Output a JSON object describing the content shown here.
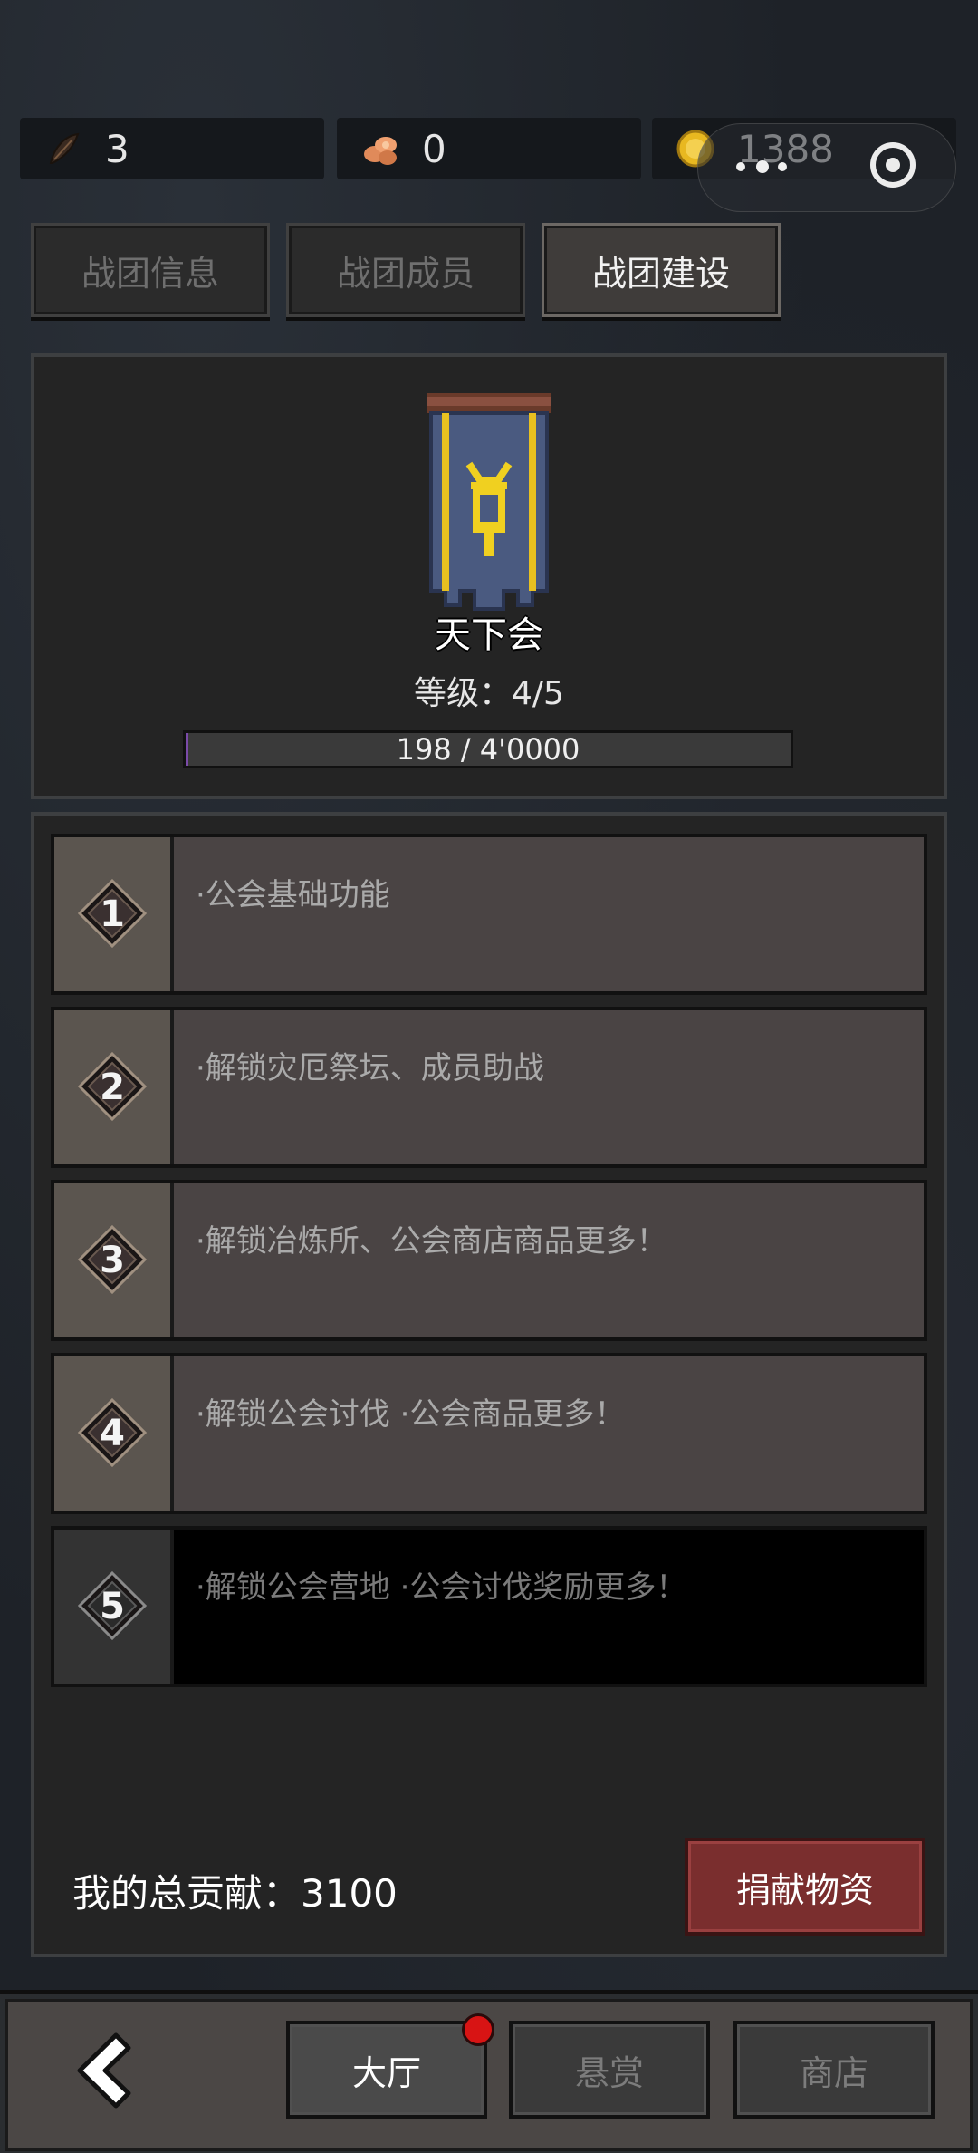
{
  "resources": {
    "feather": {
      "value": "3",
      "icon": "feather-icon"
    },
    "wood": {
      "value": "0",
      "icon": "wood-icon"
    },
    "gold": {
      "value": "1388",
      "icon": "gold-coin-icon"
    }
  },
  "tabs": [
    {
      "label": "战团信息",
      "active": false
    },
    {
      "label": "战团成员",
      "active": false
    },
    {
      "label": "战团建设",
      "active": true
    }
  ],
  "guild": {
    "name": "天下会",
    "level_text": "等级：4/5",
    "progress_text": "198 / 4'0000",
    "progress_fraction": 0.005
  },
  "levels": [
    {
      "num": "1",
      "desc": "·公会基础功能",
      "locked": false
    },
    {
      "num": "2",
      "desc": "·解锁灾厄祭坛、成员助战",
      "locked": false
    },
    {
      "num": "3",
      "desc": "·解锁冶炼所、公会商店商品更多！",
      "locked": false
    },
    {
      "num": "4",
      "desc": "·解锁公会讨伐 ·公会商品更多！",
      "locked": false
    },
    {
      "num": "5",
      "desc": "·解锁公会营地 ·公会讨伐奖励更多！",
      "locked": true
    }
  ],
  "contribution_text": "我的总贡献：3100",
  "donate_label": "捐献物资",
  "bottom_nav": [
    {
      "label": "大厅",
      "active": true,
      "badge": true
    },
    {
      "label": "悬赏",
      "active": false,
      "badge": false
    },
    {
      "label": "商店",
      "active": false,
      "badge": false
    }
  ],
  "colors": {
    "accent_red": "#7a2e2e",
    "badge_red": "#d81414",
    "banner_blue": "#4a5a80",
    "banner_gold": "#e8c020"
  }
}
